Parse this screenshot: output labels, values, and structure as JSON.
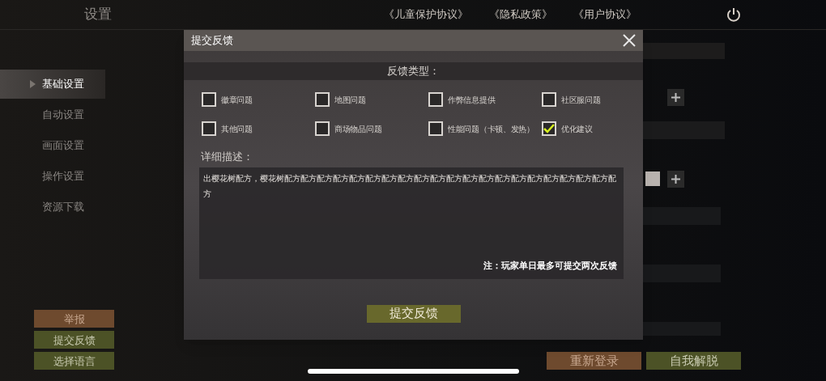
{
  "header": {
    "title": "设置",
    "links": [
      "《儿童保护协议》",
      "《隐私政策》",
      "《用户协议》"
    ]
  },
  "sidebar": {
    "items": [
      {
        "label": "基础设置",
        "selected": true
      },
      {
        "label": "自动设置",
        "selected": false
      },
      {
        "label": "画面设置",
        "selected": false
      },
      {
        "label": "操作设置",
        "selected": false
      },
      {
        "label": "资源下载",
        "selected": false
      }
    ],
    "buttons": [
      {
        "label": "举报",
        "kind": "orange"
      },
      {
        "label": "提交反馈",
        "kind": "green"
      },
      {
        "label": "选择语言",
        "kind": "green"
      }
    ]
  },
  "footer_buttons": [
    {
      "label": "重新登录",
      "kind": "orange"
    },
    {
      "label": "自我解脱",
      "kind": "green"
    }
  ],
  "dialog": {
    "title": "提交反馈",
    "type_heading": "反馈类型：",
    "options": [
      {
        "label": "徽章问题",
        "checked": false
      },
      {
        "label": "地图问题",
        "checked": false
      },
      {
        "label": "作弊信息提供",
        "checked": false
      },
      {
        "label": "社区服问题",
        "checked": false
      },
      {
        "label": "其他问题",
        "checked": false
      },
      {
        "label": "商场物品问题",
        "checked": false
      },
      {
        "label": "性能问题（卡顿、发热）",
        "checked": false
      },
      {
        "label": "优化建议",
        "checked": true
      }
    ],
    "description_label": "详细描述：",
    "description": "出樱花树配方，樱花树配方配方配方配方配方配方配方配方配方配方配方配方配方配方配方配方配方配方配方配方配方",
    "note": "注：玩家单日最多可提交两次反馈",
    "submit": "提交反馈"
  }
}
